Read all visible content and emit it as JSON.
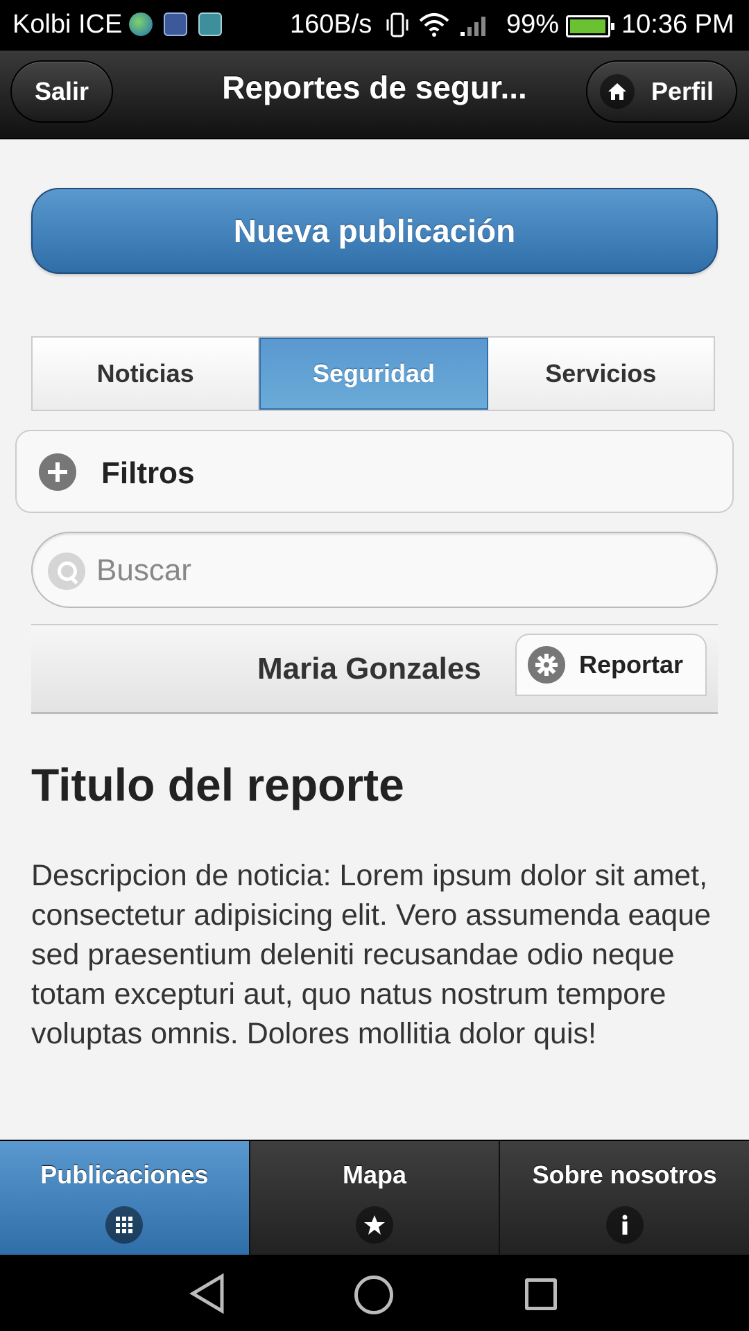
{
  "status_bar": {
    "carrier": "Kolbi ICE",
    "speed": "160B/s",
    "battery_percent": "99%",
    "battery_level": 0.99,
    "time": "10:36 PM"
  },
  "header": {
    "back_label": "Salir",
    "title": "Reportes de segur...",
    "profile_label": "Perfil"
  },
  "new_post_label": "Nueva publicación",
  "tabs": [
    {
      "label": "Noticias",
      "active": false
    },
    {
      "label": "Seguridad",
      "active": true
    },
    {
      "label": "Servicios",
      "active": false
    }
  ],
  "filters_label": "Filtros",
  "search": {
    "placeholder": "Buscar",
    "value": ""
  },
  "report": {
    "author": "Maria Gonzales",
    "report_button_label": "Reportar",
    "title": "Titulo del reporte",
    "description": "Descripcion de noticia: Lorem ipsum dolor sit amet, consectetur adipisicing elit. Vero assumenda eaque sed praesentium deleniti recusandae odio neque totam excepturi aut, quo natus nostrum tempore voluptas omnis. Dolores mollitia dolor quis!"
  },
  "navbar": [
    {
      "label": "Publicaciones",
      "icon": "grid-icon",
      "active": true
    },
    {
      "label": "Mapa",
      "icon": "star-icon",
      "active": false
    },
    {
      "label": "Sobre nosotros",
      "icon": "info-icon",
      "active": false
    }
  ],
  "colors": {
    "accent": "#3a7dbb",
    "header_bg": "#1a1a1a",
    "battery": "#6ac233"
  }
}
